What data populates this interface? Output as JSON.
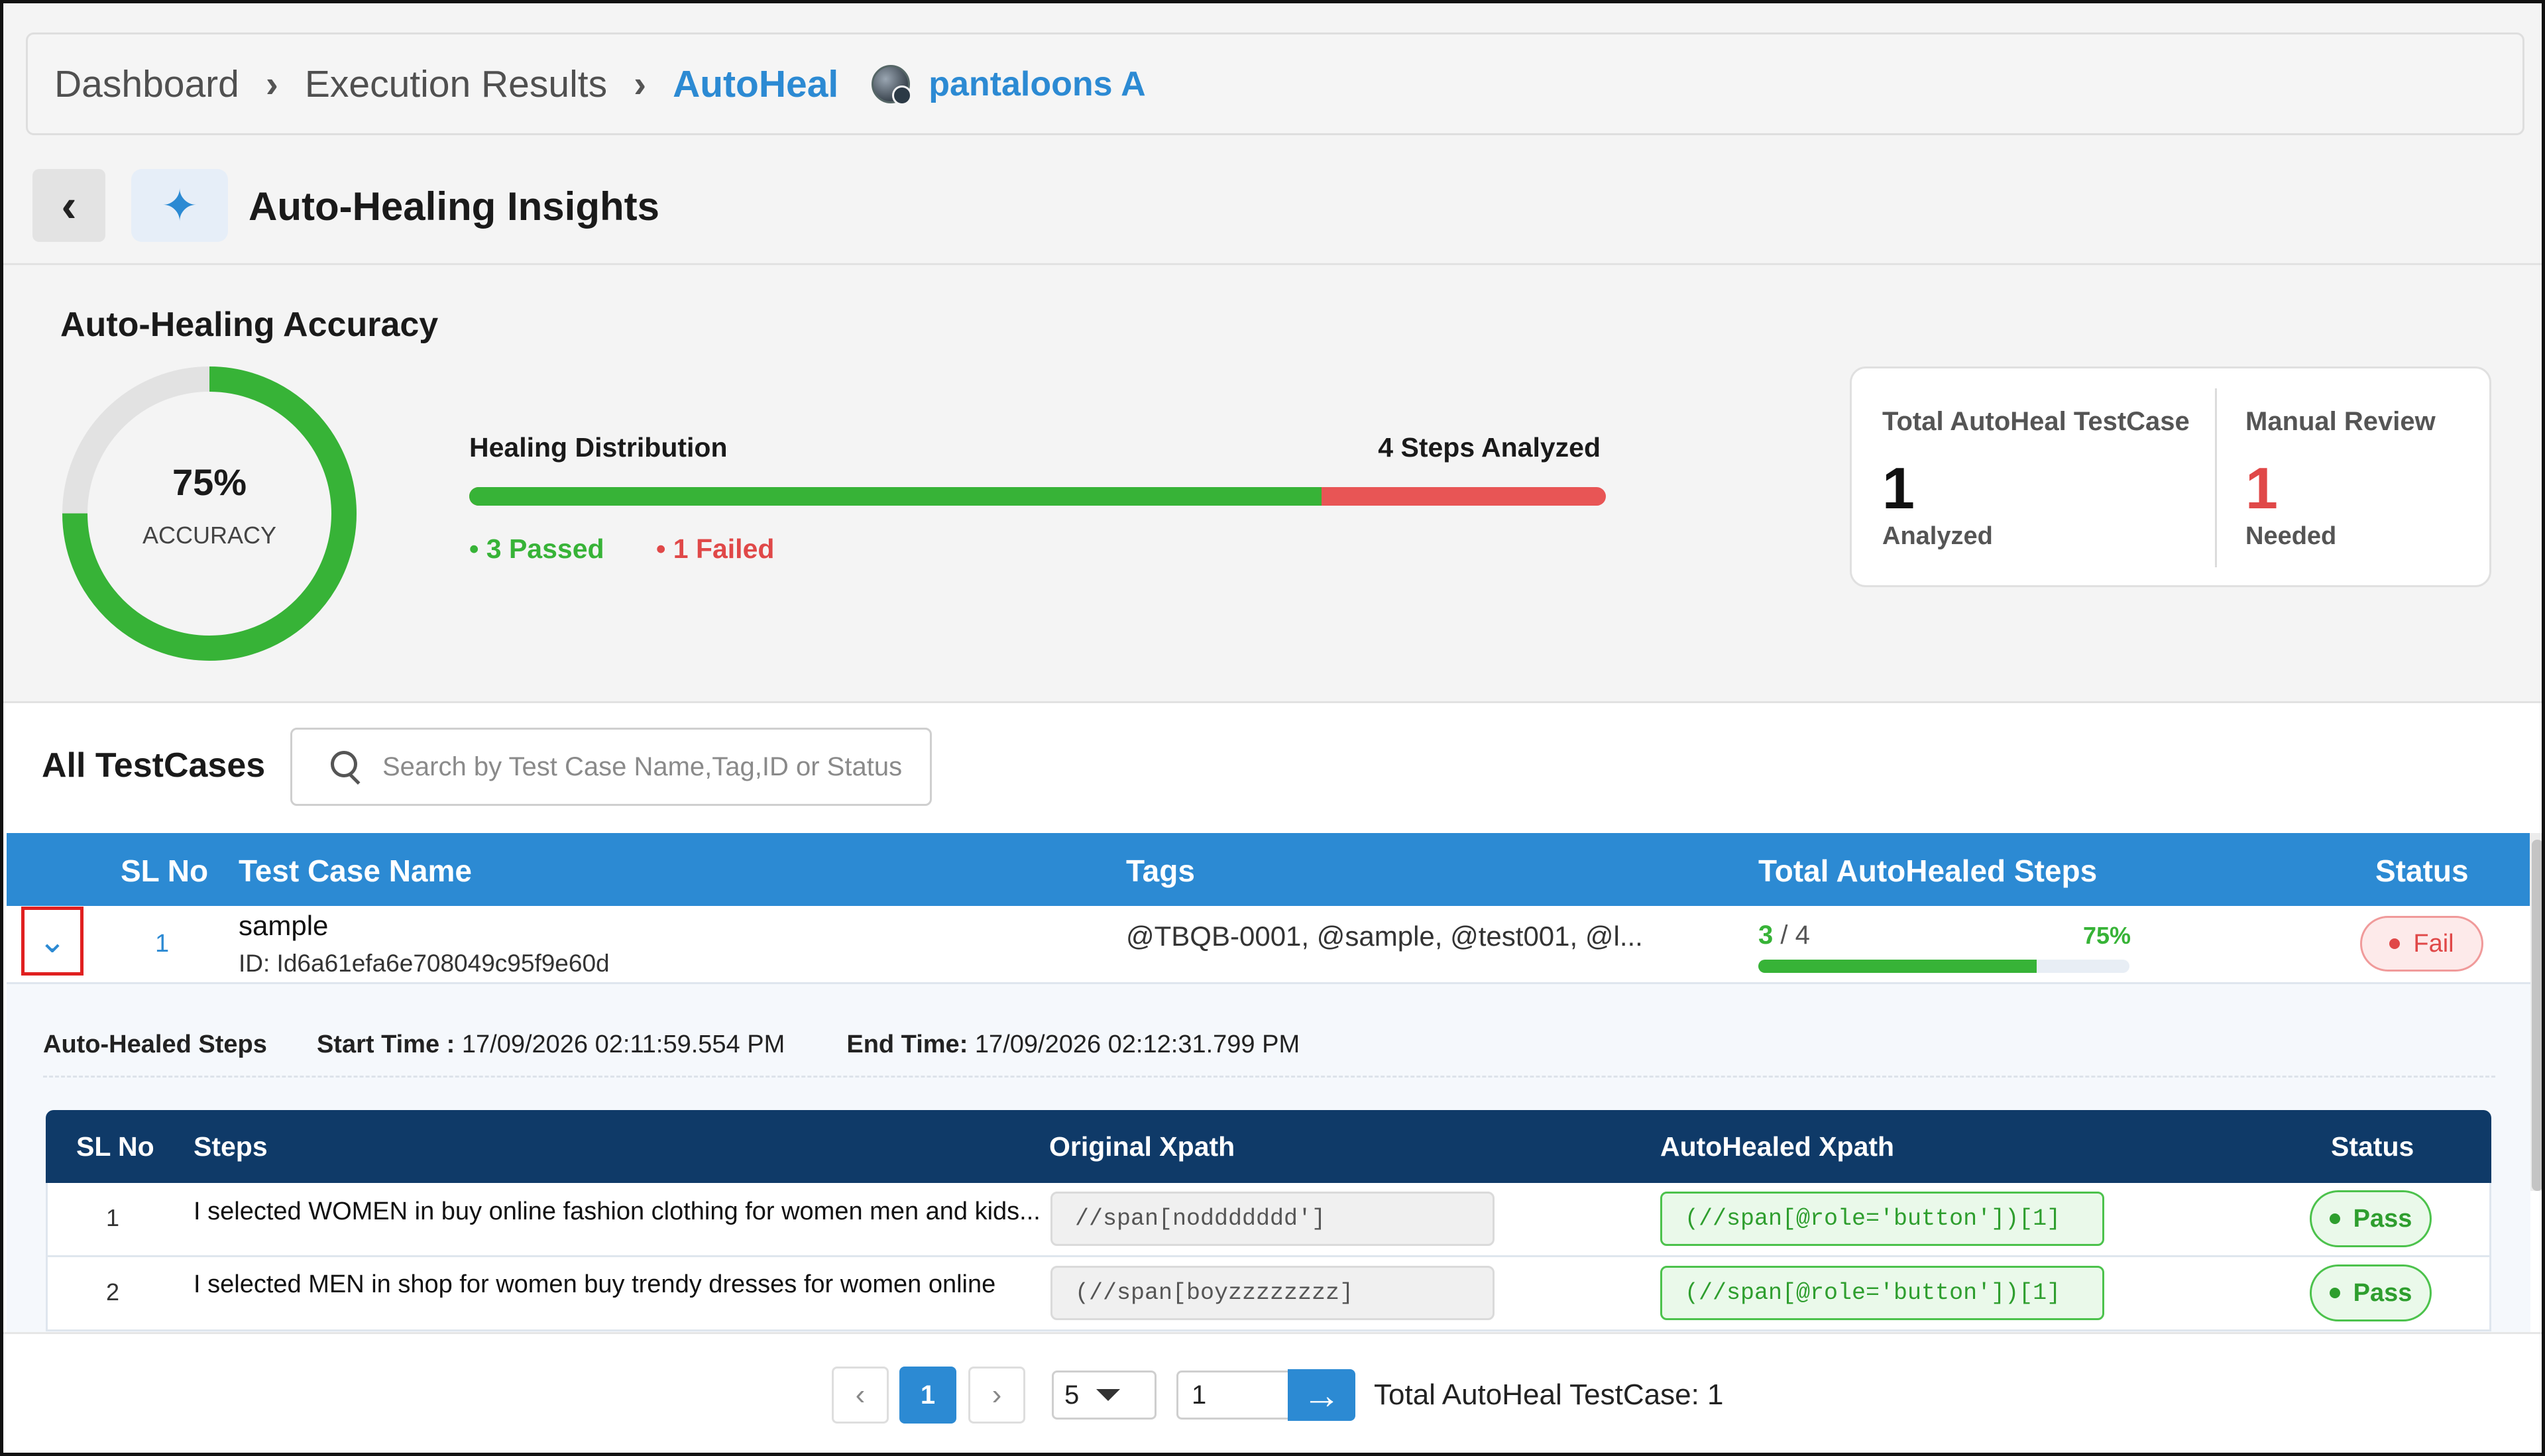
{
  "breadcrumb": {
    "items": [
      "Dashboard",
      "Execution Results",
      "AutoHeal"
    ],
    "project": "pantaloons A"
  },
  "header": {
    "title": "Auto-Healing Insights",
    "back_icon": "chevron-left-icon",
    "title_icon": "sparkle-icon"
  },
  "accuracy": {
    "title": "Auto-Healing Accuracy",
    "percent_text": "75%",
    "percent_value": 75,
    "label": "ACCURACY"
  },
  "distribution": {
    "title": "Healing Distribution",
    "steps_analyzed": "4 Steps Analyzed",
    "passed": 3,
    "failed": 1,
    "passed_label": "• 3 Passed",
    "failed_label": "• 1 Failed",
    "colors": {
      "passed": "#37b337",
      "failed": "#e85555"
    }
  },
  "stats": {
    "total": {
      "title": "Total AutoHeal TestCase",
      "value": "1",
      "sub": "Analyzed"
    },
    "manual": {
      "title": "Manual Review",
      "value": "1",
      "sub": "Needed"
    }
  },
  "testcases": {
    "title": "All TestCases",
    "search_placeholder": "Search by Test Case Name,Tag,ID or Status",
    "columns": [
      "SL No",
      "Test Case Name",
      "Tags",
      "Total AutoHealed Steps",
      "Status"
    ],
    "rows": [
      {
        "sl": "1",
        "name": "sample",
        "id": "ID: Id6a61efa6e708049c95f9e60d",
        "tags": "@TBQB-0001, @sample, @test001, @l...",
        "healed": "3",
        "total": "/ 4",
        "percent_text": "75%",
        "percent_value": 75,
        "status": "Fail"
      }
    ]
  },
  "detail": {
    "label": "Auto-Healed Steps",
    "start_key": "Start Time :",
    "start_value": "17/09/2026 02:11:59.554 PM",
    "end_key": "End Time:",
    "end_value": "17/09/2026 02:12:31.799 PM",
    "columns": [
      "SL No",
      "Steps",
      "Original Xpath",
      "AutoHealed Xpath",
      "Status"
    ],
    "rows": [
      {
        "sl": "1",
        "step": "I selected WOMEN in buy online fashion clothing for women men and kids...",
        "original": "//span[noddddddd']",
        "healed": "(//span[@role='button'])[1]",
        "status": "Pass"
      },
      {
        "sl": "2",
        "step": "I selected MEN in shop for women buy trendy dresses for women online",
        "original": "(//span[boyzzzzzzzz]",
        "healed": "(//span[@role='button'])[1]",
        "status": "Pass"
      }
    ]
  },
  "pagination": {
    "prev": "‹",
    "current_page": "1",
    "next": "›",
    "page_size": "5",
    "jump_value": "1",
    "total_text": "Total AutoHeal TestCase: 1"
  }
}
